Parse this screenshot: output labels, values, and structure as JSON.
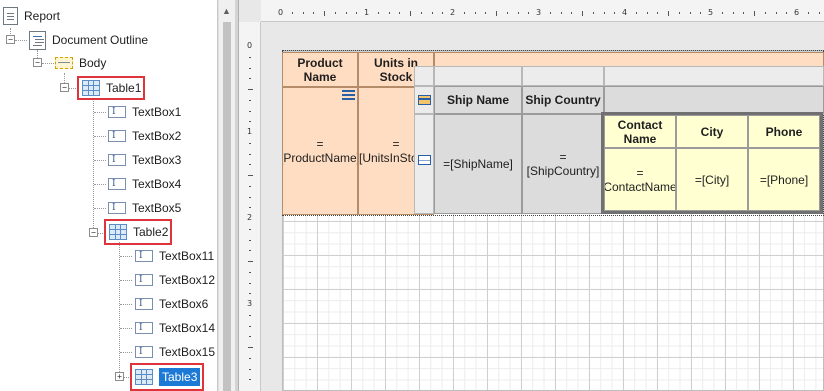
{
  "tree": {
    "report": "Report",
    "document_outline": "Document Outline",
    "body": "Body",
    "table1": "Table1",
    "table1_children": [
      "TextBox1",
      "TextBox2",
      "TextBox3",
      "TextBox4",
      "TextBox5"
    ],
    "table2": "Table2",
    "table2_children": [
      "TextBox11",
      "TextBox12",
      "TextBox6",
      "TextBox14",
      "TextBox15"
    ],
    "table3": "Table3",
    "textbox_glyph": "I",
    "expand_glyph": "+",
    "collapse_glyph": "−"
  },
  "ruler": {
    "h_numbers": [
      "0",
      "1",
      "2",
      "3",
      "4",
      "5",
      "6"
    ],
    "v_numbers": [
      "0",
      "1",
      "2",
      "3"
    ]
  },
  "table1": {
    "headers": [
      "Product Name",
      "Units in Stock"
    ],
    "cells": [
      "=[ProductName]",
      "=[UnitsInStock]"
    ]
  },
  "table2": {
    "headers": [
      "Ship Name",
      "Ship Country"
    ],
    "cells": [
      "=[ShipName]",
      "=[ShipCountry]"
    ]
  },
  "table3": {
    "headers": [
      "Contact Name",
      "City",
      "Phone"
    ],
    "cells": [
      "=[ContactName]",
      "=[City]",
      "=[Phone]"
    ]
  },
  "colors": {
    "highlight": "#e0343c",
    "selection": "#1c79d6",
    "table1_fill": "#ffddc2",
    "table2_fill": "#dcdcdc",
    "table3_fill": "#ffffd2"
  }
}
